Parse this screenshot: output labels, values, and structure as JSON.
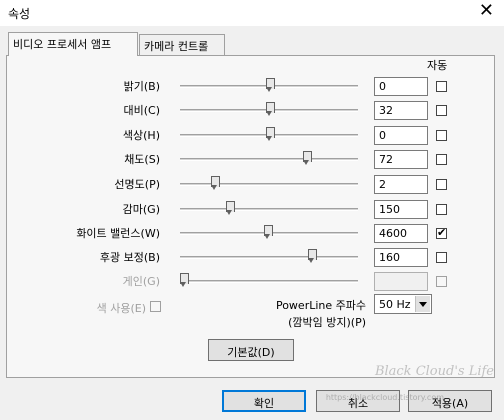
{
  "window": {
    "title": "속성",
    "close_glyph": "✕"
  },
  "tabs": [
    {
      "label": "비디오 프로세서 앰프",
      "active": true
    },
    {
      "label": "카메라 컨트롤",
      "active": false
    }
  ],
  "auto_header": "자동",
  "rows": [
    {
      "label": "밝기(B)",
      "value": "0",
      "slider": 0.5,
      "auto": false,
      "enabled": true
    },
    {
      "label": "대비(C)",
      "value": "32",
      "slider": 0.5,
      "auto": false,
      "enabled": true
    },
    {
      "label": "색상(H)",
      "value": "0",
      "slider": 0.5,
      "auto": false,
      "enabled": true
    },
    {
      "label": "채도(S)",
      "value": "72",
      "slider": 0.72,
      "auto": false,
      "enabled": true
    },
    {
      "label": "선명도(P)",
      "value": "2",
      "slider": 0.18,
      "auto": false,
      "enabled": true
    },
    {
      "label": "감마(G)",
      "value": "150",
      "slider": 0.27,
      "auto": false,
      "enabled": true
    },
    {
      "label": "화이트 밸런스(W)",
      "value": "4600",
      "slider": 0.49,
      "auto": true,
      "enabled": true
    },
    {
      "label": "후광 보정(B)",
      "value": "160",
      "slider": 0.75,
      "auto": false,
      "enabled": true
    },
    {
      "label": "게인(G)",
      "value": "",
      "slider": 0.0,
      "auto": false,
      "enabled": false
    }
  ],
  "color_use": {
    "label": "색 사용(E)",
    "checked": false,
    "enabled": false
  },
  "powerline": {
    "label_line1": "PowerLine 주파수",
    "label_line2": "(깜박임 방지)(P)",
    "selected": "50 Hz"
  },
  "default_button": "기본값(D)",
  "footer": {
    "ok": "확인",
    "cancel": "취소",
    "apply": "적용(A)"
  },
  "watermark": {
    "line1": "Black Cloud's Life",
    "line2": "https://blackcloud.tistory.com"
  }
}
